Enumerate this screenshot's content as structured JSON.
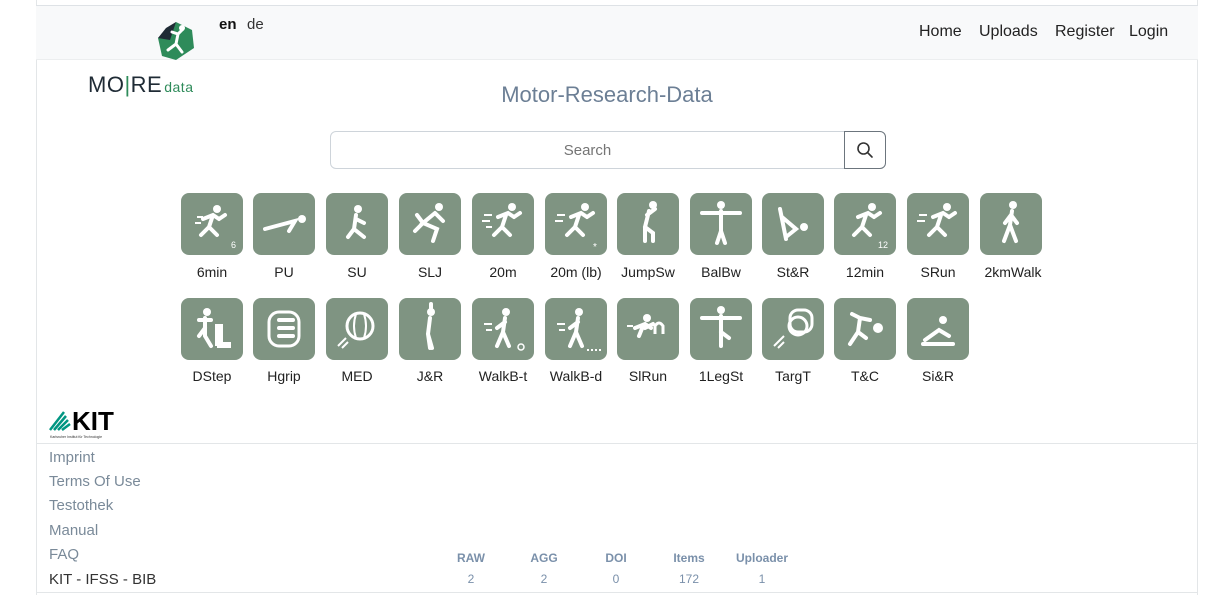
{
  "header": {
    "logo": {
      "mark_icon": "more-data-runner-logo",
      "text_main": "MO",
      "text_sep": "|",
      "text_re": "RE",
      "text_small": "data"
    },
    "languages": [
      "en",
      "de"
    ],
    "nav": [
      "Home",
      "Uploads",
      "Register",
      "Login"
    ]
  },
  "title": "Motor-Research-Data",
  "search": {
    "placeholder": "Search",
    "value": "",
    "button_icon": "search-icon"
  },
  "tests": [
    {
      "label": "6min",
      "icon": "runner-6-icon"
    },
    {
      "label": "PU",
      "icon": "push-up-icon"
    },
    {
      "label": "SU",
      "icon": "sit-up-icon"
    },
    {
      "label": "SLJ",
      "icon": "standing-long-jump-icon"
    },
    {
      "label": "20m",
      "icon": "sprint-icon"
    },
    {
      "label": "20m (lb)",
      "icon": "sprint-light-barrier-icon"
    },
    {
      "label": "JumpSw",
      "icon": "jumping-sideways-icon"
    },
    {
      "label": "BalBw",
      "icon": "balance-backwards-icon"
    },
    {
      "label": "St&R",
      "icon": "stand-and-reach-icon"
    },
    {
      "label": "12min",
      "icon": "runner-12-icon"
    },
    {
      "label": "SRun",
      "icon": "shuttle-run-icon"
    },
    {
      "label": "2kmWalk",
      "icon": "walker-icon"
    },
    {
      "label": "DStep",
      "icon": "double-step-icon"
    },
    {
      "label": "Hgrip",
      "icon": "hand-grip-icon"
    },
    {
      "label": "MED",
      "icon": "medicine-ball-icon"
    },
    {
      "label": "J&R",
      "icon": "jump-and-reach-icon"
    },
    {
      "label": "WalkB-t",
      "icon": "walking-backwards-timed-icon"
    },
    {
      "label": "WalkB-d",
      "icon": "walking-backwards-distance-icon"
    },
    {
      "label": "SlRun",
      "icon": "slalom-run-icon"
    },
    {
      "label": "1LegSt",
      "icon": "one-leg-stand-icon"
    },
    {
      "label": "TargT",
      "icon": "target-throw-icon"
    },
    {
      "label": "T&C",
      "icon": "throw-and-catch-icon"
    },
    {
      "label": "Si&R",
      "icon": "sit-and-reach-icon"
    }
  ],
  "footer": {
    "kit_logo": "KIT",
    "kit_logo_caption": "Karlsruher Institut für Technologie",
    "links": [
      "Imprint",
      "Terms Of Use",
      "Testothek",
      "Manual",
      "FAQ",
      "KIT - IFSS - BIB"
    ],
    "stats": [
      {
        "label": "RAW",
        "value": "2"
      },
      {
        "label": "AGG",
        "value": "2"
      },
      {
        "label": "DOI",
        "value": "0"
      },
      {
        "label": "Items",
        "value": "172"
      },
      {
        "label": "Uploader",
        "value": "1"
      }
    ]
  },
  "colors": {
    "tile": "#7f9482",
    "title": "#6c7f95",
    "link": "#7a8a99",
    "stats": "#7a90aa",
    "brand_green": "#2e8b5a"
  }
}
